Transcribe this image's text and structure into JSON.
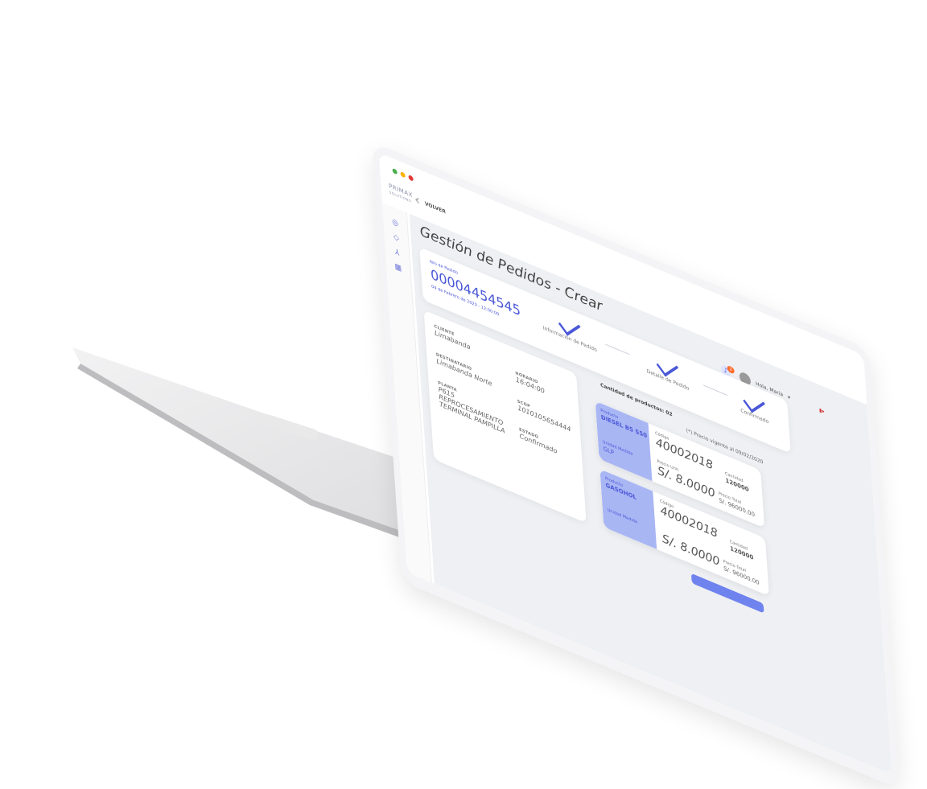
{
  "window": {
    "dots": [
      "#4caf50",
      "#ffb300",
      "#e53935"
    ],
    "brand_line1": "PRIMAX",
    "brand_line2": "SOLUTIONS"
  },
  "nav": {
    "back_label": "VOLVER"
  },
  "page": {
    "title": "Gestión de Pedidos - Crear"
  },
  "header": {
    "greeting": "Hola, Maria",
    "notification_count": "2"
  },
  "order": {
    "label": "Nro de Pedido",
    "number": "00004454545",
    "date": "04 de Febrero de 2020 - 12:00:00"
  },
  "steps": [
    {
      "label": "Información de Pedido"
    },
    {
      "label": "Detalle de Pedido"
    },
    {
      "label": "Confirmado"
    }
  ],
  "details": {
    "cliente_label": "CLIENTE",
    "cliente": "Limabanda",
    "destinatario_label": "DESTINATARIO",
    "destinatario": "Limabanda Norte",
    "planta_label": "PLANTA",
    "planta": "P615 REPROCESAMIENTO TERMINAL PAMPILLA",
    "horario_label": "HORARIO",
    "horario": "16:04:00",
    "scop_label": "SCOP",
    "scop": "1010105654444",
    "estado_label": "ESTADO",
    "estado": "Confirmado"
  },
  "products_section": {
    "count_label": "Cantidad de productos: 02",
    "price_note": "(*) Precio vigente al 09/02/2020"
  },
  "products": [
    {
      "producto_label": "Producto",
      "producto": "DIESEL B5 S50",
      "unidad_label": "Unidad Medida",
      "unidad": "GLP",
      "codigo_label": "Código",
      "codigo": "40002018",
      "cantidad_label": "Cantidad",
      "cantidad": "120000",
      "precio_unit_label": "Precio Unit",
      "precio_unit": "S/. 8.0000",
      "precio_total_label": "Precio Total",
      "precio_total": "S/. 96000.00"
    },
    {
      "producto_label": "Producto",
      "producto": "GASOHOL",
      "unidad_label": "Unidad Medida",
      "unidad": "",
      "codigo_label": "Código",
      "codigo": "40002018",
      "cantidad_label": "Cantidad",
      "cantidad": "120000",
      "precio_unit_label": "",
      "precio_unit": "S/. 8.0000",
      "precio_total_label": "Precio Total",
      "precio_total": "S/. 96000.00"
    }
  ]
}
